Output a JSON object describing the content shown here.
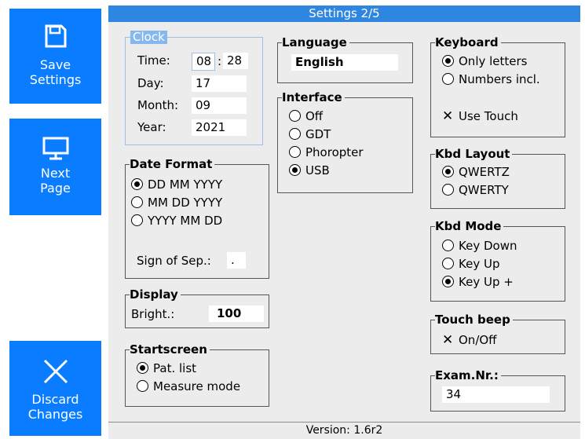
{
  "title": "Settings 2/5",
  "version": "Version: 1.6r2",
  "sidebar": {
    "save": {
      "label_line1": "Save",
      "label_line2": "Settings",
      "icon": "floppy-disk-icon"
    },
    "next": {
      "label_line1": "Next",
      "label_line2": "Page",
      "icon": "monitor-icon"
    },
    "discard": {
      "label_line1": "Discard",
      "label_line2": "Changes",
      "icon": "close-icon"
    }
  },
  "clock": {
    "title": "Clock",
    "time_label": "Time:",
    "hour": "08",
    "time_sep": ":",
    "minute": "28",
    "day_label": "Day:",
    "day": "17",
    "month_label": "Month:",
    "month": "09",
    "year_label": "Year:",
    "year": "2021"
  },
  "date_format": {
    "title": "Date Format",
    "options": [
      "DD MM YYYY",
      "MM DD YYYY",
      "YYYY MM DD"
    ],
    "selected": 0,
    "sep_label": "Sign of Sep.:",
    "sep_value": "."
  },
  "display": {
    "title": "Display",
    "bright_label": "Bright.:",
    "bright_value": "100"
  },
  "startscreen": {
    "title": "Startscreen",
    "options": [
      "Pat. list",
      "Measure mode"
    ],
    "selected": 0
  },
  "language": {
    "title": "Language",
    "value": "English"
  },
  "interface": {
    "title": "Interface",
    "options": [
      "Off",
      "GDT",
      "Phoropter",
      "USB"
    ],
    "selected": 3
  },
  "keyboard": {
    "title": "Keyboard",
    "options": [
      "Only letters",
      "Numbers incl."
    ],
    "selected": 0,
    "use_touch_label": "Use Touch",
    "use_touch_checked": true
  },
  "kbd_layout": {
    "title": "Kbd Layout",
    "options": [
      "QWERTZ",
      "QWERTY"
    ],
    "selected": 0
  },
  "kbd_mode": {
    "title": "Kbd Mode",
    "options": [
      "Key Down",
      "Key Up",
      "Key Up +"
    ],
    "selected": 2
  },
  "touch_beep": {
    "title": "Touch beep",
    "label": "On/Off",
    "checked": true
  },
  "exam_nr": {
    "title": "Exam.Nr.:",
    "value": "34"
  },
  "colors": {
    "accent": "#0a7cff",
    "title_bar": "#2f86e0",
    "panel": "#ececec"
  }
}
